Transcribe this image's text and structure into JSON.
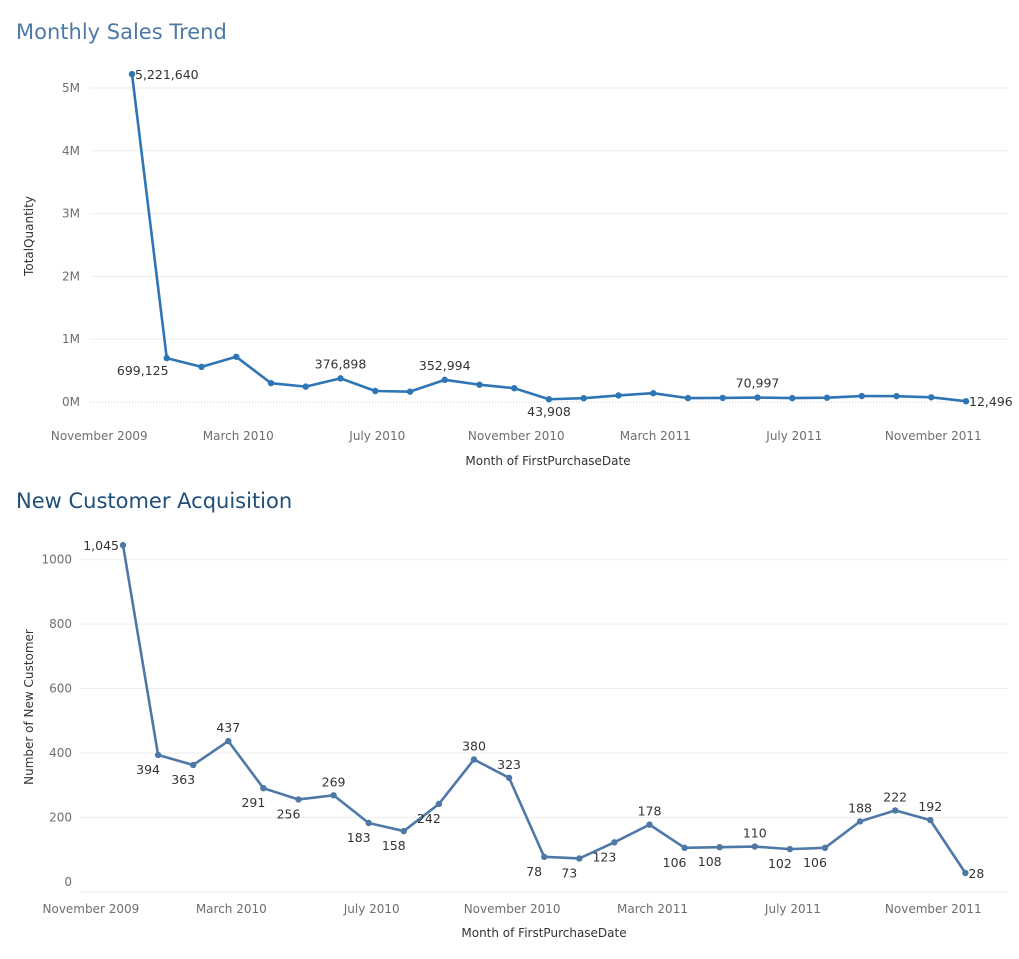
{
  "chart_data": [
    {
      "type": "line",
      "title": "Monthly Sales Trend",
      "xlabel": "Month of FirstPurchaseDate",
      "ylabel": "TotalQuantity",
      "x_ticks": [
        "November 2009",
        "March 2010",
        "July 2010",
        "November 2010",
        "March 2011",
        "July 2011",
        "November 2011"
      ],
      "y_ticks": [
        "0M",
        "1M",
        "2M",
        "3M",
        "4M",
        "5M"
      ],
      "ylim": [
        0,
        5300000
      ],
      "color": "#2e75b6",
      "x": [
        "2009-12",
        "2010-01",
        "2010-02",
        "2010-03",
        "2010-04",
        "2010-05",
        "2010-06",
        "2010-07",
        "2010-08",
        "2010-09",
        "2010-10",
        "2010-11",
        "2010-12",
        "2011-01",
        "2011-02",
        "2011-03",
        "2011-04",
        "2011-05",
        "2011-06",
        "2011-07",
        "2011-08",
        "2011-09",
        "2011-10",
        "2011-11",
        "2011-12"
      ],
      "values": [
        5221640,
        699125,
        560000,
        720000,
        300000,
        245000,
        376898,
        175000,
        165000,
        352994,
        275000,
        220000,
        43908,
        60000,
        105000,
        140000,
        62000,
        65000,
        70997,
        62000,
        68000,
        95000,
        93000,
        75000,
        12496
      ],
      "labels": [
        {
          "i": 0,
          "text": "5,221,640"
        },
        {
          "i": 1,
          "text": "699,125"
        },
        {
          "i": 6,
          "text": "376,898"
        },
        {
          "i": 9,
          "text": "352,994"
        },
        {
          "i": 12,
          "text": "43,908"
        },
        {
          "i": 18,
          "text": "70,997"
        },
        {
          "i": 24,
          "text": "12,496"
        }
      ]
    },
    {
      "type": "line",
      "title": "New Customer Acquisition",
      "xlabel": "Month of FirstPurchaseDate",
      "ylabel": "Number of New Customer",
      "x_ticks": [
        "November 2009",
        "March 2010",
        "July 2010",
        "November 2010",
        "March 2011",
        "July 2011",
        "November 2011"
      ],
      "y_ticks": [
        "0",
        "200",
        "400",
        "600",
        "800",
        "1000"
      ],
      "ylim": [
        0,
        1100
      ],
      "color": "#4e79a7",
      "x": [
        "2009-12",
        "2010-01",
        "2010-02",
        "2010-03",
        "2010-04",
        "2010-05",
        "2010-06",
        "2010-07",
        "2010-08",
        "2010-09",
        "2010-10",
        "2010-11",
        "2010-12",
        "2011-01",
        "2011-02",
        "2011-03",
        "2011-04",
        "2011-05",
        "2011-06",
        "2011-07",
        "2011-08",
        "2011-09",
        "2011-10",
        "2011-11",
        "2011-12"
      ],
      "values": [
        1045,
        394,
        363,
        437,
        291,
        256,
        269,
        183,
        158,
        242,
        380,
        323,
        78,
        73,
        123,
        178,
        106,
        108,
        110,
        102,
        106,
        188,
        222,
        192,
        28
      ],
      "value_labels": [
        "1,045",
        "394",
        "363",
        "437",
        "291",
        "256",
        "269",
        "183",
        "158",
        "242",
        "380",
        "323",
        "78",
        "73",
        "123",
        "178",
        "106",
        "108",
        "110",
        "102",
        "106",
        "188",
        "222",
        "192",
        "28"
      ]
    }
  ]
}
